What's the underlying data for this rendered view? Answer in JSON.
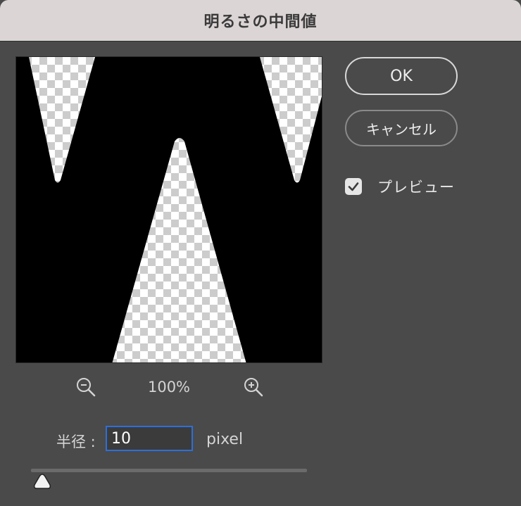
{
  "dialog": {
    "title": "明るさの中間値"
  },
  "buttons": {
    "ok_label": "OK",
    "cancel_label": "キャンセル"
  },
  "preview_option": {
    "label": "プレビュー",
    "checked": true
  },
  "zoom": {
    "level": "100%",
    "zoom_out_icon": "zoom-out-icon",
    "zoom_in_icon": "zoom-in-icon"
  },
  "radius": {
    "label": "半径 :",
    "value": "10",
    "unit": "pixel",
    "slider_fraction": 0.04
  },
  "colors": {
    "dialog_bg": "#4a4a4a",
    "titlebar_bg": "#dcd5d5",
    "input_focus": "#2d6fd9",
    "text": "#d4d4d4"
  }
}
